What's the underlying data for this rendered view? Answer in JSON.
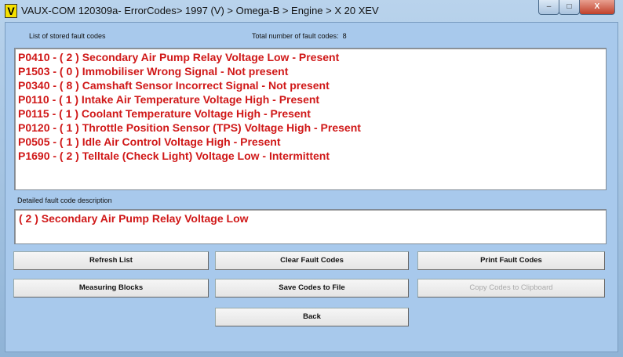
{
  "window": {
    "title": "VAUX-COM 120309a- ErrorCodes> 1997 (V) > Omega-B > Engine > X 20 XEV",
    "logo": "V",
    "minimize": "–",
    "maximize": "□",
    "close": "X"
  },
  "list": {
    "label": "List of stored fault codes",
    "total_label": "Total number of fault codes:",
    "total": "8",
    "items": [
      "P0410 - ( 2 )  Secondary Air Pump Relay Voltage Low - Present",
      "P1503 - ( 0 )  Immobiliser Wrong Signal - Not present",
      "P0340 - ( 8 )  Camshaft Sensor Incorrect Signal - Not present",
      "P0110 - ( 1 )  Intake Air Temperature Voltage High - Present",
      "P0115 - ( 1 )  Coolant Temperature Voltage High - Present",
      "P0120 - ( 1 )  Throttle Position Sensor (TPS) Voltage High - Present",
      "P0505 - ( 1 )  Idle Air Control Voltage High - Present",
      "P1690 - ( 2 )  Telltale (Check Light) Voltage Low - Intermittent"
    ]
  },
  "detail": {
    "label": "Detailed fault code description",
    "text": "( 2 )  Secondary Air Pump Relay Voltage Low"
  },
  "buttons": {
    "refresh": "Refresh List",
    "clear": "Clear Fault Codes",
    "print": "Print Fault Codes",
    "measuring": "Measuring Blocks",
    "save": "Save Codes to File",
    "copy": "Copy Codes to Clipboard",
    "back": "Back"
  },
  "colors": {
    "fault_text": "#d01818",
    "client_bg": "#a8c9ec"
  }
}
